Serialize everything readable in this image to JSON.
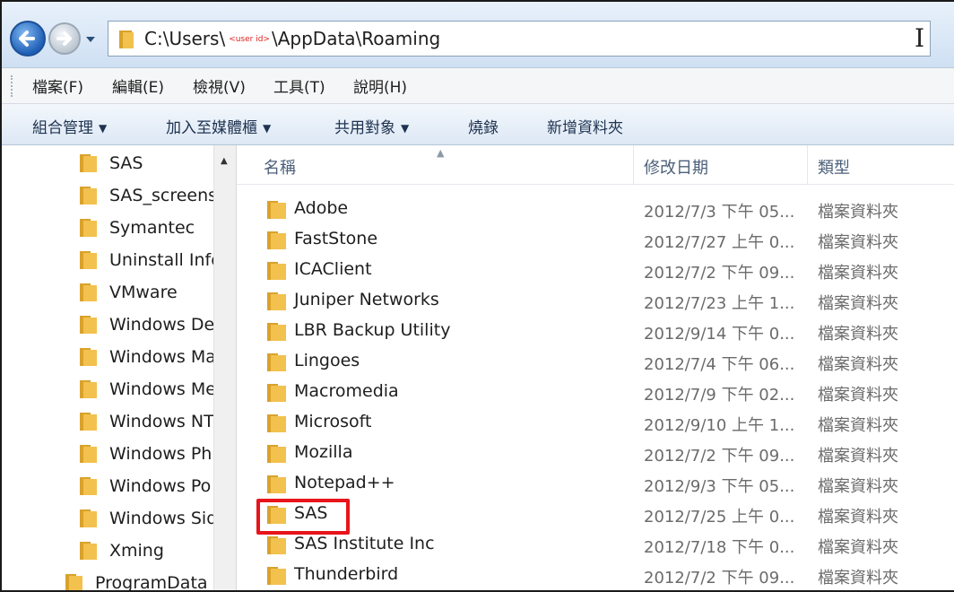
{
  "address": {
    "prefix": "C:\\Users\\",
    "userid_label": "<user id>",
    "suffix": "\\AppData\\Roaming"
  },
  "menu": [
    "檔案(F)",
    "編輯(E)",
    "檢視(V)",
    "工具(T)",
    "說明(H)"
  ],
  "commands": {
    "organize": "組合管理",
    "add_to_library": "加入至媒體櫃",
    "share_with": "共用對象",
    "burn": "燒錄",
    "new_folder": "新增資料夾"
  },
  "nav_tree": [
    "SAS",
    "SAS_screens",
    "Symantec",
    "Uninstall Info",
    "VMware",
    "Windows De",
    "Windows Ma",
    "Windows Me",
    "Windows NT",
    "Windows Ph",
    "Windows Po",
    "Windows Sid",
    "Xming",
    "ProgramData"
  ],
  "columns": {
    "name": "名稱",
    "date": "修改日期",
    "type": "類型"
  },
  "files": [
    {
      "name": "Adobe",
      "date": "2012/7/3 下午 05...",
      "type": "檔案資料夾"
    },
    {
      "name": "FastStone",
      "date": "2012/7/27 上午 0...",
      "type": "檔案資料夾"
    },
    {
      "name": "ICAClient",
      "date": "2012/7/2 下午 09...",
      "type": "檔案資料夾"
    },
    {
      "name": "Juniper Networks",
      "date": "2012/7/23 上午 1...",
      "type": "檔案資料夾"
    },
    {
      "name": "LBR Backup Utility",
      "date": "2012/9/14 下午 0...",
      "type": "檔案資料夾"
    },
    {
      "name": "Lingoes",
      "date": "2012/7/4 下午 06...",
      "type": "檔案資料夾"
    },
    {
      "name": "Macromedia",
      "date": "2012/7/9 下午 02...",
      "type": "檔案資料夾"
    },
    {
      "name": "Microsoft",
      "date": "2012/9/10 上午 1...",
      "type": "檔案資料夾"
    },
    {
      "name": "Mozilla",
      "date": "2012/7/2 下午 09...",
      "type": "檔案資料夾"
    },
    {
      "name": "Notepad++",
      "date": "2012/9/3 下午 05...",
      "type": "檔案資料夾"
    },
    {
      "name": "SAS",
      "date": "2012/7/25 上午 0...",
      "type": "檔案資料夾"
    },
    {
      "name": "SAS Institute Inc",
      "date": "2012/7/18 下午 0...",
      "type": "檔案資料夾"
    },
    {
      "name": "Thunderbird",
      "date": "2012/7/2 下午 09...",
      "type": "檔案資料夾"
    }
  ],
  "colors": {
    "highlight": "#e8141b",
    "folder": "#f2c14e"
  },
  "icons": [
    "back-arrow-icon",
    "forward-arrow-icon",
    "folder-icon",
    "sort-up-icon",
    "dropdown-caret-icon",
    "text-cursor-icon"
  ]
}
